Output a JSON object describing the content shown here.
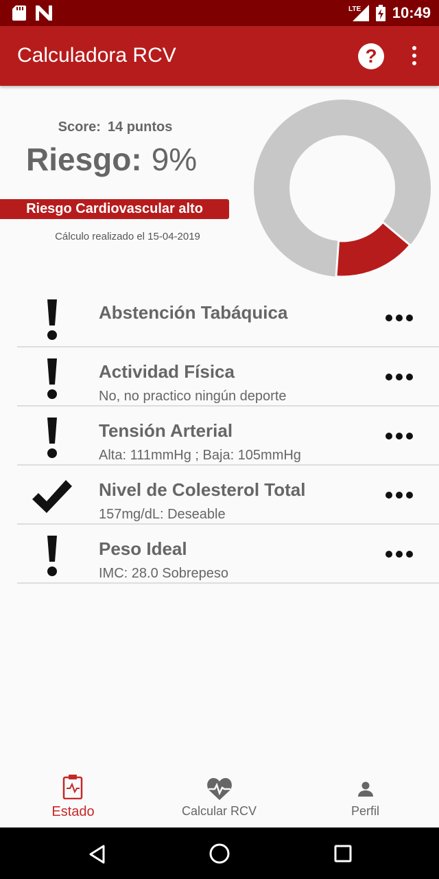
{
  "status_bar": {
    "time": "10:49",
    "network": "LTE"
  },
  "app_bar": {
    "title": "Calculadora RCV",
    "help_icon": "help-circle-icon",
    "menu_icon": "more-vert-icon"
  },
  "summary": {
    "score_label": "Score:",
    "score_value": "14 puntos",
    "risk_label": "Riesgo:",
    "risk_value": "9%",
    "risk_fraction": 0.15,
    "risk_badge": "Riesgo Cardiovascular alto",
    "calc_date": "Cálculo realizado el 15-04-2019",
    "colors": {
      "accent": "#b71c1c",
      "ring": "#c7c7c7"
    }
  },
  "factors": [
    {
      "title": "Abstención Tabáquica",
      "subtitle": "",
      "status": "warning"
    },
    {
      "title": "Actividad Física",
      "subtitle": " No, no practico ningún deporte",
      "status": "warning"
    },
    {
      "title": "Tensión Arterial",
      "subtitle": "Alta: 111mmHg ; Baja: 105mmHg",
      "status": "warning"
    },
    {
      "title": "Nivel de Colesterol Total",
      "subtitle": "157mg/dL: Deseable",
      "status": "ok"
    },
    {
      "title": "Peso Ideal",
      "subtitle": "IMC: 28.0 Sobrepeso",
      "status": "warning"
    }
  ],
  "bottom_nav": {
    "tabs": [
      {
        "label": "Estado",
        "icon": "clipboard-icon",
        "active": true
      },
      {
        "label": "Calcular RCV",
        "icon": "heart-pulse-icon",
        "active": false
      },
      {
        "label": "Perfil",
        "icon": "person-icon",
        "active": false
      }
    ]
  }
}
